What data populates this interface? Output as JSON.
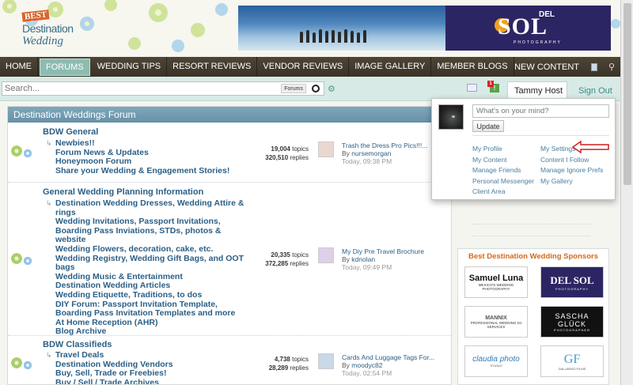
{
  "logo": {
    "line1": "BEST",
    "line2": "Destination",
    "line3": "Wedding"
  },
  "banner": {
    "del": "DEL",
    "sol": "SOL",
    "photo": "PHOTOGRAPHY"
  },
  "nav": {
    "items": [
      "HOME",
      "FORUMS",
      "WEDDING TIPS",
      "RESORT REVIEWS",
      "VENDOR REVIEWS",
      "IMAGE GALLERY",
      "MEMBER BLOGS"
    ],
    "active": "FORUMS",
    "new_content": "NEW CONTENT"
  },
  "toolbar": {
    "search_placeholder": "Search...",
    "search_scope": "Forums",
    "notif_count": "1",
    "user_name": "Tammy Host",
    "sign_out": "Sign Out"
  },
  "forum": {
    "header": "Destination Weddings Forum",
    "categories": [
      {
        "title": "BDW General",
        "subforums": [
          "Newbies!!",
          "Forum News & Updates",
          "Honeymoon Forum",
          "Share your Wedding & Engagement Stories!"
        ],
        "topics": "19,004",
        "topics_label": "topics",
        "replies": "320,510",
        "replies_label": "replies",
        "last_title": "Trash the Dress Pro Pics!!!...",
        "last_by": "By",
        "last_author": "nursemorgan",
        "last_date": "Today, 09:38 PM"
      },
      {
        "title": "General Wedding Planning Information",
        "subforums": [
          "Destination Wedding Dresses, Wedding Attire & rings",
          "Wedding Invitations, Passport Invitations, Boarding Pass Inviations, STDs, photos & website",
          "Wedding Flowers, decoration, cake, etc.",
          "Wedding Registry, Wedding Gift Bags, and OOT bags",
          "Wedding Music & Entertainment",
          "Destination Wedding Articles",
          "Wedding Etiquette, Traditions, to dos",
          "DIY Forum: Passport Invitation Template, Boarding Pass Invitation Templates and more",
          "At Home Reception (AHR)",
          "Blog Archive"
        ],
        "topics": "20,335",
        "topics_label": "topics",
        "replies": "372,285",
        "replies_label": "replies",
        "last_title": "My Diy Pre Travel Brochure",
        "last_by": "By",
        "last_author": "kdnolan",
        "last_date": "Today, 09:49 PM"
      },
      {
        "title": "BDW Classifieds",
        "subforums": [
          "Travel Deals",
          "Destination Wedding Vendors",
          "Buy, Sell, Trade or Freebies!",
          "Buy / Sell / Trade Archives"
        ],
        "topics": "4,738",
        "topics_label": "topics",
        "replies": "28,289",
        "replies_label": "replies",
        "last_title": "Cards And Luggage Tags For...",
        "last_by": "By",
        "last_author": "moodyc82",
        "last_date": "Today, 02:54 PM"
      }
    ]
  },
  "dropdown": {
    "mind_placeholder": "What's on your mind?",
    "update": "Update",
    "links_left": [
      "My Profile",
      "My Content",
      "Manage Friends",
      "Personal Messenger",
      "Client Area"
    ],
    "links_right": [
      "My Settings",
      "Content I Follow",
      "Manage Ignore Prefs",
      "My Gallery"
    ]
  },
  "sponsors": {
    "title": "Best Destination Wedding Sponsors",
    "items": [
      {
        "name": "Samuel Luna",
        "tag": "MEXICO'S WEDDING PHOTOGRAPHY"
      },
      {
        "name": "DEL SOL",
        "tag": "PHOTOGRAPHY"
      },
      {
        "name": "MANNIX",
        "tag": "PROFESSIONAL WEDDING DJ SERVICES"
      },
      {
        "name": "SASCHA GLÜCK",
        "tag": "PHOTOGRAPHER"
      },
      {
        "name": "claudia photo",
        "tag": "STUDIO"
      },
      {
        "name": "GF",
        "tag": "GALLARDO FILMS"
      }
    ]
  },
  "colors": {
    "nav_bg": "#3a3226",
    "nav_active": "#8dbcb0",
    "forum_header": "#6890a6",
    "link": "#2b5f86",
    "sponsor_title": "#d2691e"
  }
}
